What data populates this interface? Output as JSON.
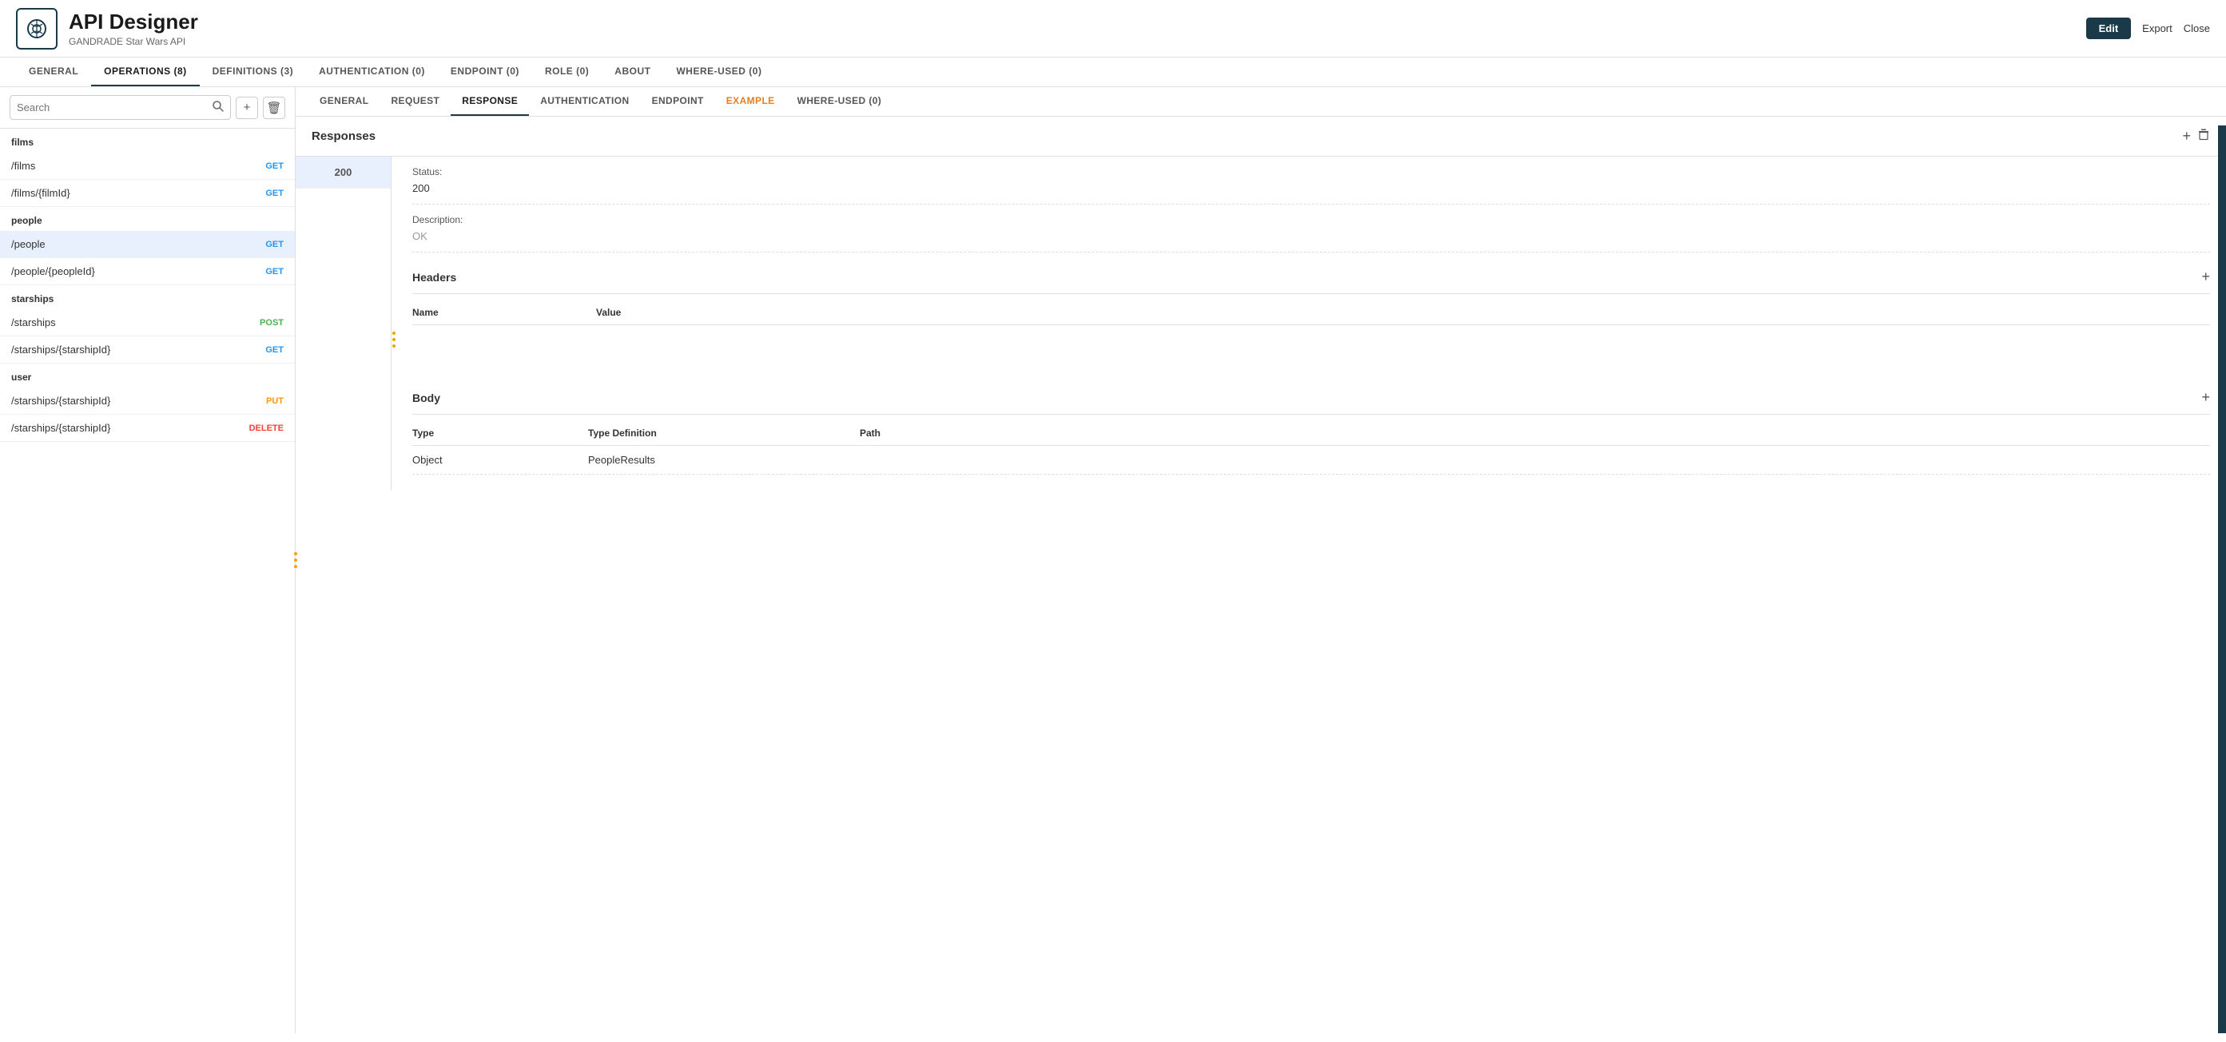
{
  "app": {
    "logo_icon": "☯",
    "title": "API Designer",
    "subtitle": "GANDRADE Star Wars API",
    "btn_edit": "Edit",
    "btn_export": "Export",
    "btn_close": "Close"
  },
  "top_nav": {
    "items": [
      {
        "label": "GENERAL",
        "active": false
      },
      {
        "label": "OPERATIONS (8)",
        "active": true
      },
      {
        "label": "DEFINITIONS (3)",
        "active": false
      },
      {
        "label": "AUTHENTICATION (0)",
        "active": false
      },
      {
        "label": "ENDPOINT (0)",
        "active": false
      },
      {
        "label": "ROLE (0)",
        "active": false
      },
      {
        "label": "ABOUT",
        "active": false
      },
      {
        "label": "WHERE-USED (0)",
        "active": false
      }
    ]
  },
  "sidebar": {
    "search_placeholder": "Search",
    "groups": [
      {
        "label": "films",
        "items": [
          {
            "path": "/films",
            "method": "GET",
            "active": false
          },
          {
            "path": "/films/{filmId}",
            "method": "GET",
            "active": false
          }
        ]
      },
      {
        "label": "people",
        "items": [
          {
            "path": "/people",
            "method": "GET",
            "active": true
          },
          {
            "path": "/people/{peopleId}",
            "method": "GET",
            "active": false
          }
        ]
      },
      {
        "label": "starships",
        "items": [
          {
            "path": "/starships",
            "method": "POST",
            "active": false
          },
          {
            "path": "/starships/{starshipId}",
            "method": "GET",
            "active": false
          }
        ]
      },
      {
        "label": "user",
        "items": [
          {
            "path": "/starships/{starshipId}",
            "method": "PUT",
            "active": false
          },
          {
            "path": "/starships/{starshipId}",
            "method": "DELETE",
            "active": false
          }
        ]
      }
    ]
  },
  "sub_tabs": [
    {
      "label": "GENERAL",
      "active": false
    },
    {
      "label": "REQUEST",
      "active": false
    },
    {
      "label": "RESPONSE",
      "active": true
    },
    {
      "label": "AUTHENTICATION",
      "active": false
    },
    {
      "label": "ENDPOINT",
      "active": false
    },
    {
      "label": "EXAMPLE",
      "active": false,
      "orange": true
    },
    {
      "label": "WHERE-USED (0)",
      "active": false
    }
  ],
  "responses": {
    "section_title": "Responses",
    "codes": [
      {
        "code": "200",
        "active": true
      }
    ],
    "status_label": "Status:",
    "status_value": "200",
    "description_label": "Description:",
    "description_placeholder": "OK",
    "headers": {
      "section_title": "Headers",
      "col_name": "Name",
      "col_value": "Value"
    },
    "body": {
      "section_title": "Body",
      "col_type": "Type",
      "col_typedef": "Type Definition",
      "col_path": "Path",
      "rows": [
        {
          "type": "Object",
          "typedef": "PeopleResults",
          "path": ""
        }
      ]
    }
  }
}
